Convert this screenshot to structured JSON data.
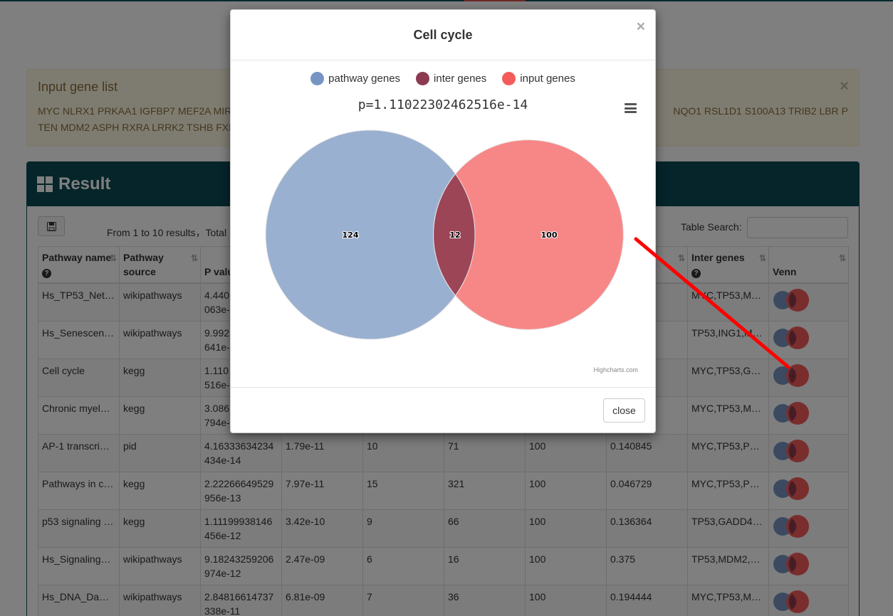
{
  "alert": {
    "title": "Input gene list",
    "genes_line1": "MYC NLRX1 PRKAA1 IGFBP7 MEF2A MIR5",
    "genes_line1_right": "NQO1 RSL1D1 S100A13 TRIB2 LBR P",
    "genes_line2": "TEN MDM2 ASPH RXRA LRRK2 TSHB FXR",
    "close": "×"
  },
  "panel": {
    "title": "Result",
    "info": "From 1 to 10 results，Total",
    "search_label": "Table Search:",
    "search_placeholder": ""
  },
  "table": {
    "headers": [
      "Pathway name",
      "Pathway source",
      "P value",
      "",
      "",
      "",
      "",
      "",
      "Inter genes",
      "Venn"
    ],
    "rows": [
      [
        "Hs_TP53_Net…",
        "wikipathways",
        "4.440",
        "063e-",
        "",
        "",
        "",
        "",
        "MYC,TP53,M…"
      ],
      [
        "Hs_Senescen…",
        "wikipathways",
        "9.992",
        "641e-",
        "",
        "",
        "",
        "",
        "TP53,ING1,M…"
      ],
      [
        "Cell cycle",
        "kegg",
        "1.110",
        "516e-",
        "",
        "",
        "",
        "",
        "MYC,TP53,G…"
      ],
      [
        "Chronic myel…",
        "kegg",
        "3.086",
        "794e-",
        "",
        "",
        "",
        "",
        "MYC,TP53,M…"
      ],
      [
        "AP-1 transcri…",
        "pid",
        "4.16333634234",
        "434e-14",
        "1.79e-11",
        "10",
        "71",
        "100",
        "0.140845",
        "MYC,TP53,P…"
      ],
      [
        "Pathways in c…",
        "kegg",
        "2.22266649529",
        "956e-13",
        "7.97e-11",
        "15",
        "321",
        "100",
        "0.046729",
        "MYC,TP53,P…"
      ],
      [
        "p53 signaling …",
        "kegg",
        "1.11199938146",
        "456e-12",
        "3.42e-10",
        "9",
        "66",
        "100",
        "0.136364",
        "TP53,GADD4…"
      ],
      [
        "Hs_Signaling…",
        "wikipathways",
        "9.18243259206",
        "974e-12",
        "2.47e-09",
        "6",
        "16",
        "100",
        "0.375",
        "TP53,MDM2,…"
      ],
      [
        "Hs_DNA_Dam…",
        "wikipathways",
        "2.84816614737",
        "338e-11",
        "6.81e-09",
        "7",
        "36",
        "100",
        "0.194444",
        "MYC,TP53,M…"
      ]
    ]
  },
  "modal": {
    "title": "Cell cycle",
    "close_x": "×",
    "close_button": "close",
    "chart_title": "p=1.11022302462516e-14",
    "credits": "Highcharts.com"
  },
  "colors": {
    "pathway": "#7795c3",
    "inter": "#8c3a4f",
    "input": "#f45b5b",
    "panel": "#0a4a55"
  },
  "chart_data": {
    "type": "venn",
    "title": "p=1.11022302462516e-14",
    "legend": [
      "pathway genes",
      "inter genes",
      "input genes"
    ],
    "sets": [
      {
        "name": "pathway genes",
        "value": 124
      },
      {
        "name": "inter genes",
        "value": 12
      },
      {
        "name": "input genes",
        "value": 100
      }
    ]
  }
}
